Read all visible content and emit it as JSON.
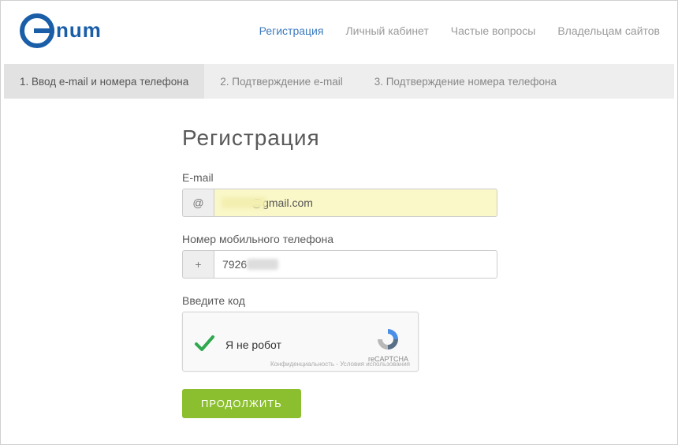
{
  "logo_text": "enum",
  "nav": {
    "registration": "Регистрация",
    "account": "Личный кабинет",
    "faq": "Частые вопросы",
    "owners": "Владельцам сайтов"
  },
  "steps": {
    "s1": "1. Ввод e-mail и номера телефона",
    "s2": "2. Подтверждение e-mail",
    "s3": "3. Подтверждение номера телефона"
  },
  "page": {
    "title": "Регистрация",
    "email_label": "E-mail",
    "email_prefix": "@",
    "email_value_suffix": "@gmail.com",
    "phone_label": "Номер мобильного телефона",
    "phone_prefix": "+",
    "phone_value_prefix": "7926",
    "captcha_label": "Введите код",
    "captcha_text": "Я не робот",
    "captcha_brand": "reCAPTCHA",
    "captcha_terms": "Конфиденциальность - Условия использования",
    "continue": "ПРОДОЛЖИТЬ"
  }
}
